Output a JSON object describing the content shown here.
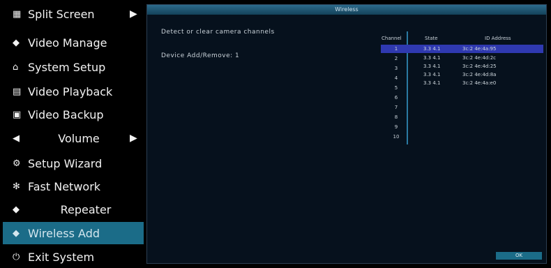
{
  "menu": {
    "items": [
      {
        "icon": "▦",
        "label": "Split Screen",
        "arrow": "▶"
      },
      {
        "icon": "◆",
        "label": "Video Manage"
      },
      {
        "icon": "⌂",
        "label": "System Setup"
      },
      {
        "icon": "▤",
        "label": "Video Playback"
      },
      {
        "icon": "▣",
        "label": "Video Backup"
      },
      {
        "icon": "◀",
        "label": "Volume",
        "arrow": "▶"
      },
      {
        "icon": "⚙",
        "label": "Setup Wizard"
      },
      {
        "icon": "✻",
        "label": "Fast Network"
      },
      {
        "icon": "◆",
        "label": "Repeater"
      },
      {
        "icon": "◆",
        "label": "Wireless Add"
      },
      {
        "icon": "⏻",
        "label": "Exit System"
      }
    ]
  },
  "panel": {
    "title": "Wireless",
    "info_line1": "Detect or clear camera channels",
    "info_line2": "Device Add/Remove: 1",
    "table": {
      "col_channel": "Channel",
      "col_state": "State",
      "col_id": "ID Address",
      "channel_numbers": [
        "1",
        "2",
        "3",
        "4",
        "5",
        "6",
        "7",
        "8",
        "9",
        "10"
      ],
      "rows": [
        {
          "state": "3.3 4.1",
          "id": "3c:2 4e:4a:95"
        },
        {
          "state": "3.3 4.1",
          "id": "3c:2 4e:4d:2c"
        },
        {
          "state": "3.3 4.1",
          "id": "3c:2 4e:4d:25"
        },
        {
          "state": "3.3 4.1",
          "id": "3c:2 4e:4d:8a"
        },
        {
          "state": "3.3 4.1",
          "id": "3c:2 4e:4a:e0"
        }
      ]
    },
    "button_label": "OK"
  }
}
